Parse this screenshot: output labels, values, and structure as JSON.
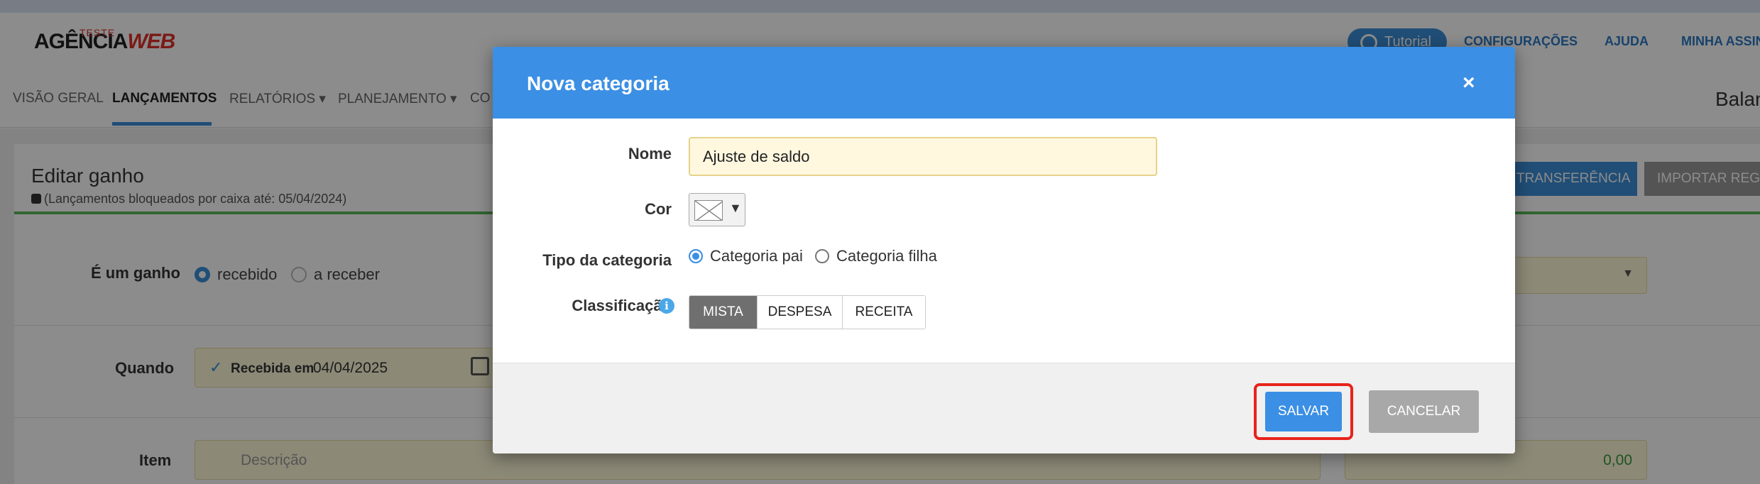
{
  "header": {
    "logo_top": "TESTE",
    "logo_main": "AGÊNCIA",
    "logo_accent": "WEB",
    "tutorial_label": "Tutorial",
    "links": [
      "CONFIGURAÇÕES",
      "AJUDA",
      "MINHA ASSINATURA"
    ]
  },
  "nav": {
    "items": [
      "VISÃO GERAL",
      "LANÇAMENTOS",
      "RELATÓRIOS ▾",
      "PLANEJAMENTO ▾",
      "CO"
    ],
    "active": "LANÇAMENTOS",
    "right_label": "Balan"
  },
  "page": {
    "title": "Editar ganho",
    "subtitle": "(Lançamentos bloqueados por caixa até: 05/04/2024)",
    "transfer_button": "TRANSFERÊNCIA",
    "import_button": "IMPORTAR REGRAS",
    "ganho_label": "É um ganho",
    "ganho_options": [
      "recebido",
      "a receber"
    ],
    "quando_label": "Quando",
    "quando_status": "Recebida em",
    "quando_date": "04/04/2025",
    "item_label": "Item",
    "item_placeholder": "Descrição",
    "value": "0,00"
  },
  "modal": {
    "title": "Nova categoria",
    "close_glyph": "×",
    "name_label": "Nome",
    "name_value": "Ajuste de saldo",
    "color_label": "Cor",
    "type_label": "Tipo da categoria",
    "type_options": [
      "Categoria pai",
      "Categoria filha"
    ],
    "type_selected": "Categoria pai",
    "class_label": "Classificação",
    "class_options": [
      "MISTA",
      "DESPESA",
      "RECEITA"
    ],
    "class_selected": "MISTA",
    "save_label": "SALVAR",
    "cancel_label": "CANCELAR"
  },
  "colors": {
    "primary": "#3b8fe4",
    "highlight": "#e8231b",
    "selected_segment": "#6f6f6f"
  }
}
